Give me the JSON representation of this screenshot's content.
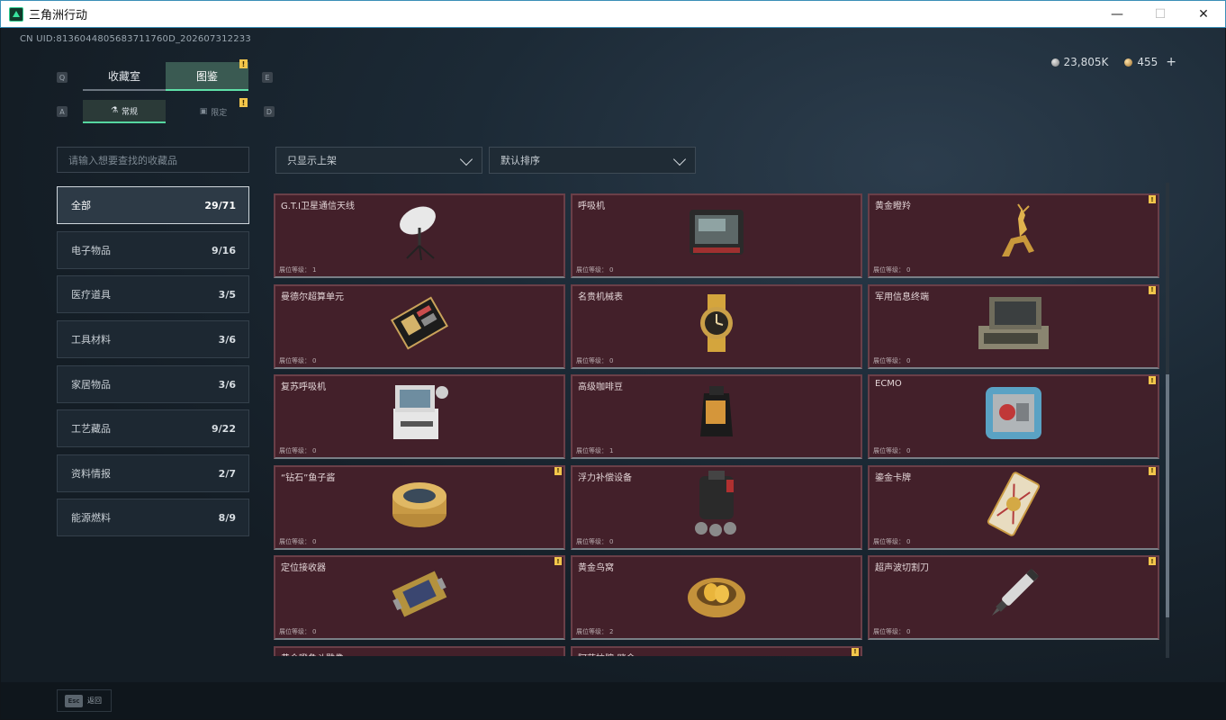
{
  "window": {
    "title": "三角洲行动",
    "min_glyph": "—",
    "max_glyph": "☐",
    "close_glyph": "✕"
  },
  "uid": "CN UID:8136044805683711760D_202607312233",
  "currency": {
    "silver": "23,805K",
    "gold": "455",
    "plus": "+"
  },
  "tabs": {
    "key_left": "Q",
    "key_right": "E",
    "collection_room": "收藏室",
    "atlas": "图鉴",
    "sub_key_left": "A",
    "sub_key_right": "D",
    "normal": "常规",
    "limited": "限定",
    "warn": "!"
  },
  "search": {
    "placeholder": "请输入想要查找的收藏品"
  },
  "filters": {
    "display_filter": "只显示上架",
    "sort": "默认排序"
  },
  "categories": [
    {
      "label": "全部",
      "count": "29/71"
    },
    {
      "label": "电子物品",
      "count": "9/16"
    },
    {
      "label": "医疗道具",
      "count": "3/5"
    },
    {
      "label": "工具材料",
      "count": "3/6"
    },
    {
      "label": "家居物品",
      "count": "3/6"
    },
    {
      "label": "工艺藏品",
      "count": "9/22"
    },
    {
      "label": "资料情报",
      "count": "2/7"
    },
    {
      "label": "能源燃料",
      "count": "8/9"
    }
  ],
  "level_label": "展位等级：",
  "items": [
    {
      "name": "G.T.I卫星通信天线",
      "level": "1",
      "icon": "satellite-dish-icon",
      "badge": false
    },
    {
      "name": "呼吸机",
      "level": "0",
      "icon": "ventilator-icon",
      "badge": false
    },
    {
      "name": "黄金瞪羚",
      "level": "0",
      "icon": "gold-gazelle-icon",
      "badge": true
    },
    {
      "name": "曼德尔超算单元",
      "level": "0",
      "icon": "supercomputer-unit-icon",
      "badge": false
    },
    {
      "name": "名贵机械表",
      "level": "0",
      "icon": "luxury-watch-icon",
      "badge": false
    },
    {
      "name": "军用信息终端",
      "level": "0",
      "icon": "military-terminal-icon",
      "badge": true
    },
    {
      "name": "复苏呼吸机",
      "level": "0",
      "icon": "resuscitator-icon",
      "badge": false
    },
    {
      "name": "高级咖啡豆",
      "level": "1",
      "icon": "coffee-bag-icon",
      "badge": false
    },
    {
      "name": "ECMO",
      "level": "0",
      "icon": "ecmo-machine-icon",
      "badge": true
    },
    {
      "name": "“钻石”鱼子酱",
      "level": "0",
      "icon": "caviar-tin-icon",
      "badge": true
    },
    {
      "name": "浮力补偿设备",
      "level": "0",
      "icon": "buoyancy-device-icon",
      "badge": false
    },
    {
      "name": "鎏金卡牌",
      "level": "0",
      "icon": "gilded-card-icon",
      "badge": true
    },
    {
      "name": "定位接收器",
      "level": "0",
      "icon": "gps-receiver-icon",
      "badge": true
    },
    {
      "name": "黄金鸟窝",
      "level": "2",
      "icon": "golden-nest-icon",
      "badge": false
    },
    {
      "name": "超声波切割刀",
      "level": "0",
      "icon": "ultrasonic-cutter-icon",
      "badge": true
    },
    {
      "name": "黄金瞪角斗雕像",
      "level": "",
      "icon": "gold-statue-icon",
      "badge": false
    },
    {
      "name": "阿萨拉牌-赌命",
      "level": "",
      "icon": "asara-card-icon",
      "badge": true
    }
  ],
  "footer": {
    "esc": "Esc",
    "back": "返回"
  },
  "colors": {
    "accent_green": "#5fe0a8",
    "card_bg": "#43202a",
    "warning_yellow": "#f2c64b"
  }
}
